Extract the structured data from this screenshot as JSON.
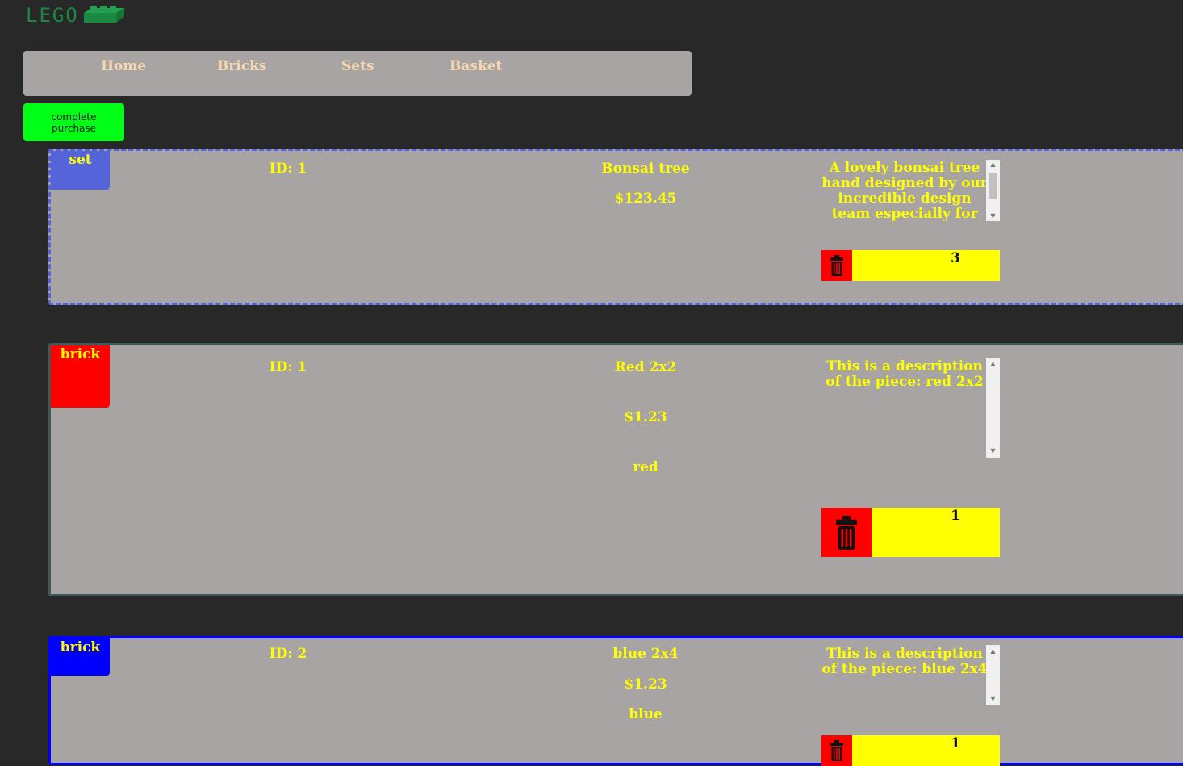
{
  "header": {
    "logo_text": "LEGO"
  },
  "nav": {
    "items": [
      "Home",
      "Bricks",
      "Sets",
      "Basket"
    ]
  },
  "actions": {
    "complete_purchase": "complete purchase"
  },
  "colors": {
    "background": "#282828",
    "panel": "#a8a4a3",
    "nav_text": "#f7d7b0",
    "card_text": "#ffff00",
    "purchase_button": "#00ff16",
    "delete_button": "#ff0000",
    "quantity_bg": "#ffff00",
    "logo": "#1a8a42"
  },
  "basket": {
    "items": [
      {
        "type": "set",
        "type_color": "#5664d9",
        "id_text": "ID: 1",
        "name": "Bonsai tree",
        "price": "$123.45",
        "description": "A lovely bonsai tree hand designed by our incredible design team especially for",
        "quantity": "3",
        "delete_icon": "trash-icon"
      },
      {
        "type": "brick",
        "type_color": "#ff0000",
        "id_text": "ID: 1",
        "name": "Red 2x2",
        "price": "$1.23",
        "colour": "red",
        "description": "This is a description of the piece: red 2x2",
        "quantity": "1",
        "delete_icon": "trash-icon"
      },
      {
        "type": "brick",
        "type_color": "#0000ff",
        "id_text": "ID: 2",
        "name": "blue 2x4",
        "price": "$1.23",
        "colour": "blue",
        "description": "This is a description of the piece: blue 2x4",
        "quantity": "1",
        "delete_icon": "trash-icon"
      }
    ]
  }
}
